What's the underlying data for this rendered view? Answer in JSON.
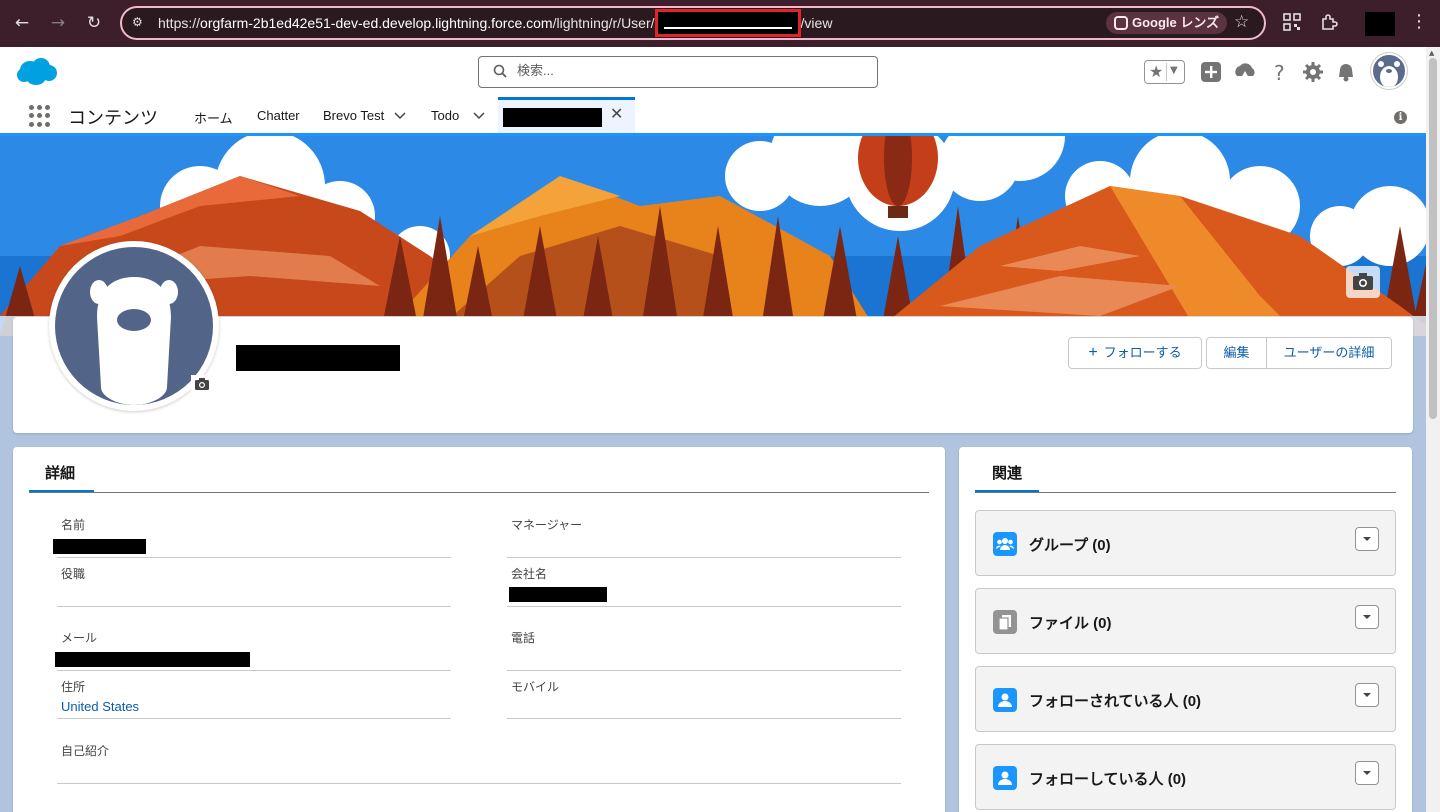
{
  "browser": {
    "url_prefix": "https://",
    "url_host": "orgfarm-2b1ed42e51-dev-ed.develop.lightning.force.com",
    "url_path": "/lightning/r/User/",
    "url_suffix": "/view",
    "lens_label": "Google レンズ"
  },
  "header": {
    "search_placeholder": "検索..."
  },
  "appnav": {
    "app_name": "コンテンツ",
    "items": [
      {
        "label": "ホーム"
      },
      {
        "label": "Chatter"
      },
      {
        "label": "Brevo Test"
      },
      {
        "label": "Todo"
      }
    ],
    "info": "i"
  },
  "profile": {
    "follow_button": "フォローする",
    "edit_button": "編集",
    "user_detail_button": "ユーザーの詳細"
  },
  "details": {
    "tab": "詳細",
    "fields": {
      "name": "名前",
      "manager": "マネージャー",
      "title": "役職",
      "company": "会社名",
      "email": "メール",
      "phone": "電話",
      "address": "住所",
      "address_value": "United States",
      "mobile": "モバイル",
      "about": "自己紹介"
    }
  },
  "related": {
    "tab": "関連",
    "items": [
      {
        "label": "グループ (0)",
        "icon": "groups-icon",
        "color": "#1b96ff"
      },
      {
        "label": "ファイル (0)",
        "icon": "file-icon",
        "color": "#939393"
      },
      {
        "label": "フォローされている人 (0)",
        "icon": "user-icon",
        "color": "#1b96ff"
      },
      {
        "label": "フォローしている人 (0)",
        "icon": "user-icon",
        "color": "#1b96ff"
      }
    ]
  },
  "colors": {
    "brand": "#0176d3",
    "link": "#0b5cab",
    "chrome": "#3c1f2a"
  }
}
